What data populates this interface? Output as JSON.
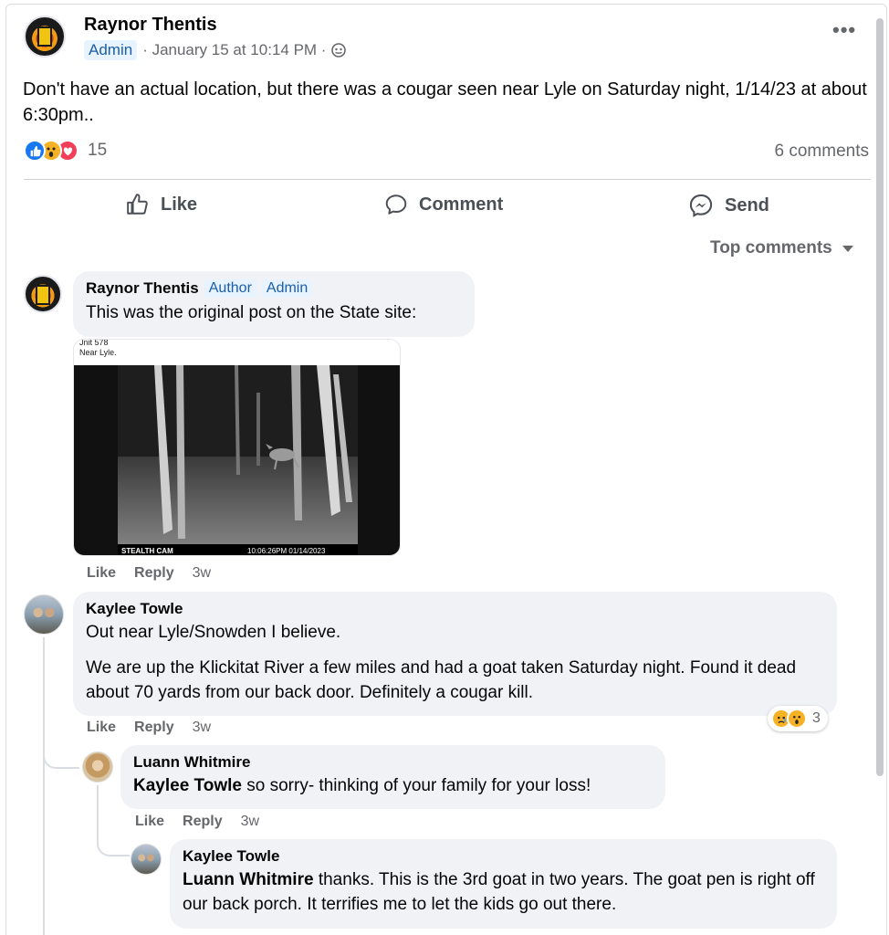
{
  "post": {
    "author": "Raynor Thentis",
    "badge": "Admin",
    "meta": "· January 15 at 10:14 PM ·",
    "text": "Don't have an actual location, but there was a cougar seen near Lyle on Saturday night, 1/14/23 at about 6:30pm..",
    "reaction_count": "15",
    "comments_count": "6 comments"
  },
  "actions": {
    "like": "Like",
    "comment": "Comment",
    "send": "Send"
  },
  "sort_label": "Top comments",
  "comments": [
    {
      "name": "Raynor Thentis",
      "badges": [
        "Author",
        "Admin"
      ],
      "text": "This was the original post on the State site:",
      "image": {
        "caption_line1": "Jnit 578",
        "caption_line2": "Near Lyle.",
        "cam_brand": "STEALTH CAM",
        "timestamp": "10:06:26PM 01/14/2023"
      },
      "like": "Like",
      "reply": "Reply",
      "age": "3w"
    },
    {
      "name": "Kaylee Towle",
      "text1": "Out near Lyle/Snowden I believe.",
      "text2": "We are up the Klickitat River a few miles and had a goat taken Saturday night. Found it dead about 70 yards from our back door. Definitely a cougar kill.",
      "reaction_count": "3",
      "like": "Like",
      "reply": "Reply",
      "age": "3w"
    },
    {
      "name": "Luann Whitmire",
      "mention": "Kaylee Towle",
      "text": " so sorry- thinking of your family for your loss!",
      "like": "Like",
      "reply": "Reply",
      "age": "3w"
    },
    {
      "name": "Kaylee Towle",
      "mention": "Luann Whitmire",
      "text": " thanks. This is the 3rd goat in two years. The goat pen is right off our back porch. It terrifies me to let the kids go out there."
    }
  ],
  "colors": {
    "like_blue": "#1877f2",
    "love_red": "#f33e58",
    "wow_yellow": "#f7b125",
    "badge_bg": "#e7f3ff",
    "badge_text": "#1b5ea8"
  }
}
